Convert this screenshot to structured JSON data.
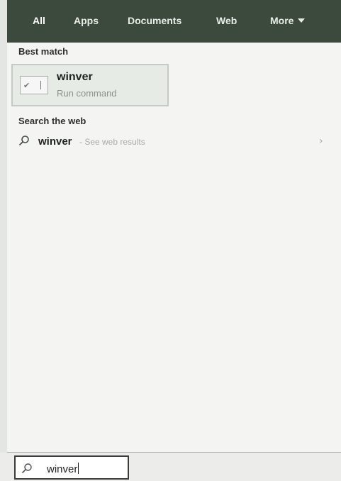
{
  "tabs": [
    {
      "label": "All",
      "active": true
    },
    {
      "label": "Apps",
      "active": false
    },
    {
      "label": "Documents",
      "active": false
    },
    {
      "label": "Web",
      "active": false
    },
    {
      "label": "More",
      "active": false
    }
  ],
  "best_match": {
    "heading": "Best match",
    "title": "winver",
    "subtitle": "Run command",
    "icon": "run-command-icon"
  },
  "web": {
    "heading": "Search the web",
    "term": "winver",
    "hint": "- See web results",
    "icon": "search-icon",
    "arrow": "›"
  },
  "searchbox": {
    "value": "winver",
    "icon": "search-icon"
  },
  "colors": {
    "tabbar": "#3b4a3c",
    "panel": "#f4f4f3",
    "best_card": "#e7ebe6"
  }
}
